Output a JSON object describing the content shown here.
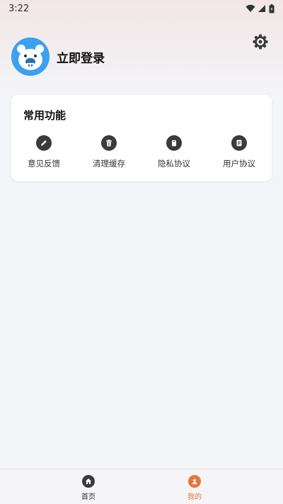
{
  "status_bar": {
    "time": "3:22"
  },
  "profile": {
    "login_label": "立即登录"
  },
  "functions_card": {
    "title": "常用功能",
    "items": [
      {
        "label": "意见反馈",
        "icon": "pencil-icon"
      },
      {
        "label": "清理缓存",
        "icon": "trash-icon"
      },
      {
        "label": "隐私协议",
        "icon": "bookmark-icon"
      },
      {
        "label": "用户协议",
        "icon": "document-icon"
      }
    ]
  },
  "bottom_nav": {
    "items": [
      {
        "label": "首页",
        "icon": "home-icon",
        "active": false
      },
      {
        "label": "我的",
        "icon": "user-icon",
        "active": true
      }
    ]
  },
  "colors": {
    "accent": "#e8763a",
    "icon_dark": "#3b3b3b",
    "avatar_bg": "#3ba0f0"
  }
}
